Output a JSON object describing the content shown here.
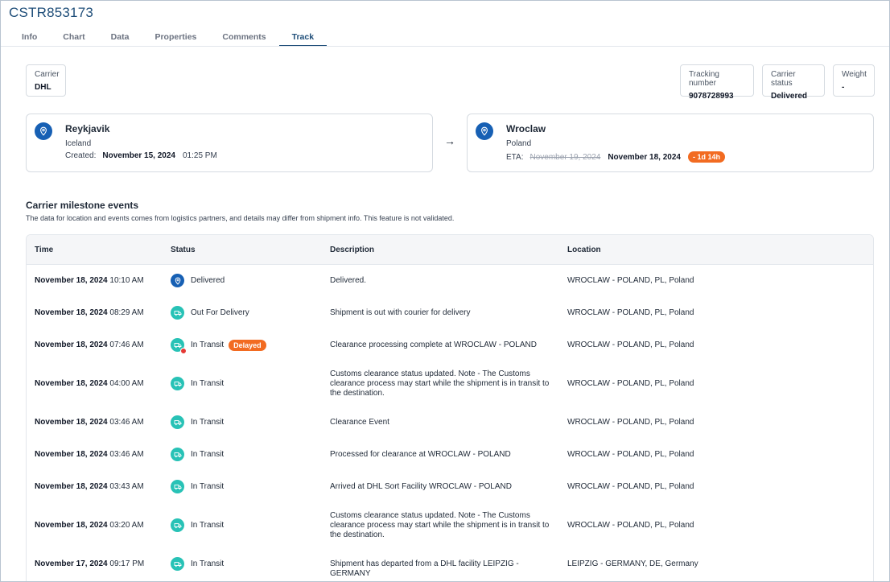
{
  "header": {
    "title": "CSTR853173"
  },
  "tabs": [
    {
      "label": "Info"
    },
    {
      "label": "Chart"
    },
    {
      "label": "Data"
    },
    {
      "label": "Properties"
    },
    {
      "label": "Comments"
    },
    {
      "label": "Track",
      "active": true
    }
  ],
  "carrier": {
    "label": "Carrier",
    "value": "DHL"
  },
  "tracking": {
    "label": "Tracking number",
    "value": "9078728993"
  },
  "carrier_status": {
    "label": "Carrier status",
    "value": "Delivered"
  },
  "weight": {
    "label": "Weight",
    "value": "-"
  },
  "origin": {
    "city": "Reykjavik",
    "country": "Iceland",
    "created_label": "Created:",
    "created_date": "November 15, 2024",
    "created_time": "01:25 PM"
  },
  "destination": {
    "city": "Wroclaw",
    "country": "Poland",
    "eta_label": "ETA:",
    "eta_original": "November 19, 2024",
    "eta_actual": "November 18, 2024",
    "eta_diff": "- 1d 14h"
  },
  "arrow": "→",
  "milestones": {
    "title": "Carrier milestone events",
    "subtitle": "The data for location and events comes from logistics partners, and details may differ from shipment info. This feature is not validated.",
    "columns": {
      "time": "Time",
      "status": "Status",
      "description": "Description",
      "location": "Location"
    },
    "rows": [
      {
        "date": "November 18, 2024",
        "time": "10:10 AM",
        "icon": "pin-icon",
        "status": "Delivered",
        "badge": "",
        "description": "Delivered.",
        "location": "WROCLAW - POLAND, PL, Poland"
      },
      {
        "date": "November 18, 2024",
        "time": "08:29 AM",
        "icon": "truck-icon",
        "status": "Out For Delivery",
        "badge": "",
        "description": "Shipment is out with courier for delivery",
        "location": "WROCLAW - POLAND, PL, Poland"
      },
      {
        "date": "November 18, 2024",
        "time": "07:46 AM",
        "icon": "truck-icon",
        "status": "In Transit",
        "badge": "Delayed",
        "description": "Clearance processing complete at WROCLAW - POLAND",
        "location": "WROCLAW - POLAND, PL, Poland"
      },
      {
        "date": "November 18, 2024",
        "time": "04:00 AM",
        "icon": "truck-icon",
        "status": "In Transit",
        "badge": "",
        "description": "Customs clearance status updated. Note - The Customs clearance process may start while the shipment is in transit to the destination.",
        "location": "WROCLAW - POLAND, PL, Poland"
      },
      {
        "date": "November 18, 2024",
        "time": "03:46 AM",
        "icon": "truck-icon",
        "status": "In Transit",
        "badge": "",
        "description": "Clearance Event",
        "location": "WROCLAW - POLAND, PL, Poland"
      },
      {
        "date": "November 18, 2024",
        "time": "03:46 AM",
        "icon": "truck-icon",
        "status": "In Transit",
        "badge": "",
        "description": "Processed for clearance at WROCLAW - POLAND",
        "location": "WROCLAW - POLAND, PL, Poland"
      },
      {
        "date": "November 18, 2024",
        "time": "03:43 AM",
        "icon": "truck-icon",
        "status": "In Transit",
        "badge": "",
        "description": "Arrived at DHL Sort Facility WROCLAW - POLAND",
        "location": "WROCLAW - POLAND, PL, Poland"
      },
      {
        "date": "November 18, 2024",
        "time": "03:20 AM",
        "icon": "truck-icon",
        "status": "In Transit",
        "badge": "",
        "description": "Customs clearance status updated. Note - The Customs clearance process may start while the shipment is in transit to the destination.",
        "location": "WROCLAW - POLAND, PL, Poland"
      },
      {
        "date": "November 17, 2024",
        "time": "09:17 PM",
        "icon": "truck-icon",
        "status": "In Transit",
        "badge": "",
        "description": "Shipment has departed from a DHL facility LEIPZIG - GERMANY",
        "location": "LEIPZIG - GERMANY, DE, Germany"
      }
    ]
  }
}
